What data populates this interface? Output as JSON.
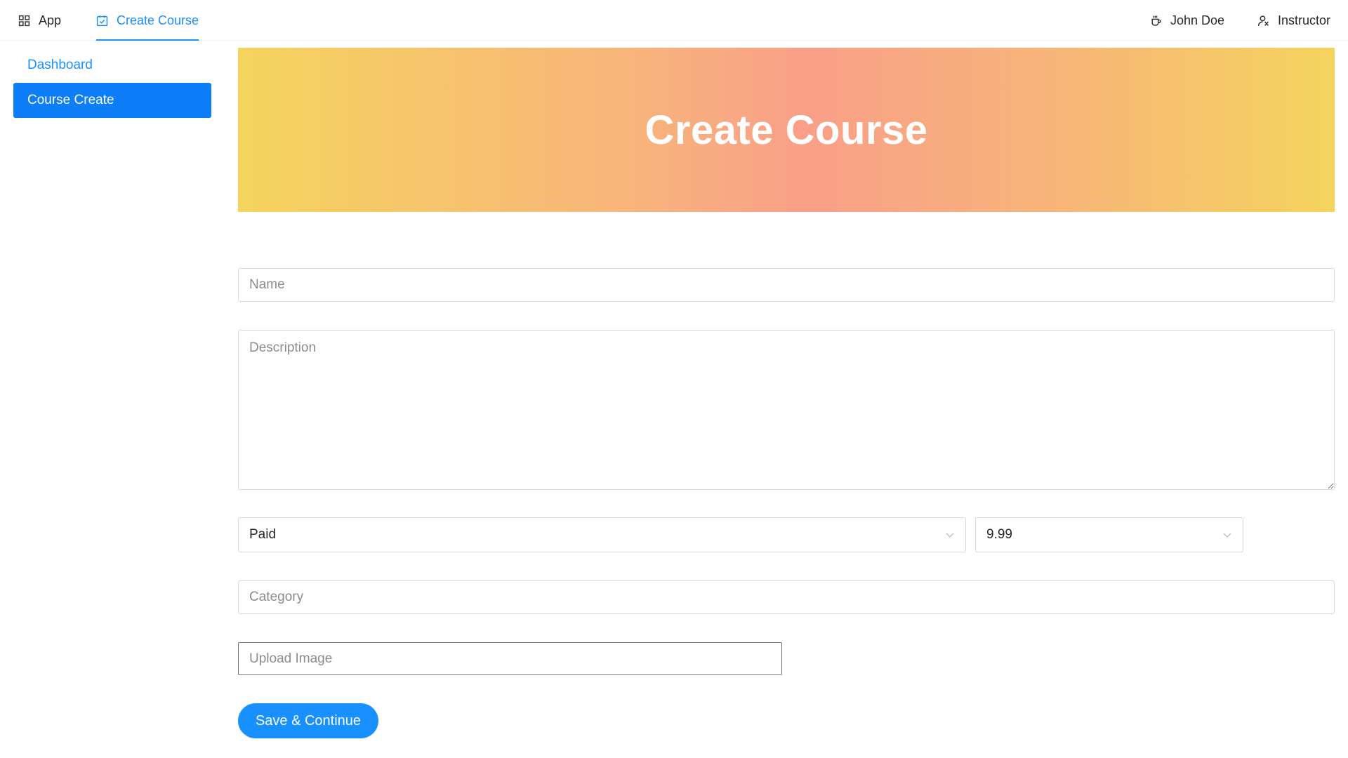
{
  "topnav": {
    "app_label": "App",
    "create_course_label": "Create Course",
    "user_label": "John Doe",
    "instructor_label": "Instructor"
  },
  "sidebar": {
    "items": [
      {
        "label": "Dashboard",
        "selected": false
      },
      {
        "label": "Course Create",
        "selected": true
      }
    ]
  },
  "hero": {
    "title": "Create Course"
  },
  "form": {
    "name_placeholder": "Name",
    "description_placeholder": "Description",
    "paid_select_value": "Paid",
    "price_select_value": "9.99",
    "category_placeholder": "Category",
    "upload_placeholder": "Upload Image",
    "submit_label": "Save & Continue"
  },
  "colors": {
    "accent": "#1890ff",
    "sidebar_selected": "#0d7df8",
    "hero_gradient": [
      "#f5d45e",
      "#f99f88",
      "#f5d45e"
    ]
  },
  "icons": {
    "app": "appstore-icon",
    "create_course": "carry-out-icon",
    "user": "coffee-icon",
    "instructor": "team-icon",
    "select_arrow": "chevron-down-icon"
  }
}
